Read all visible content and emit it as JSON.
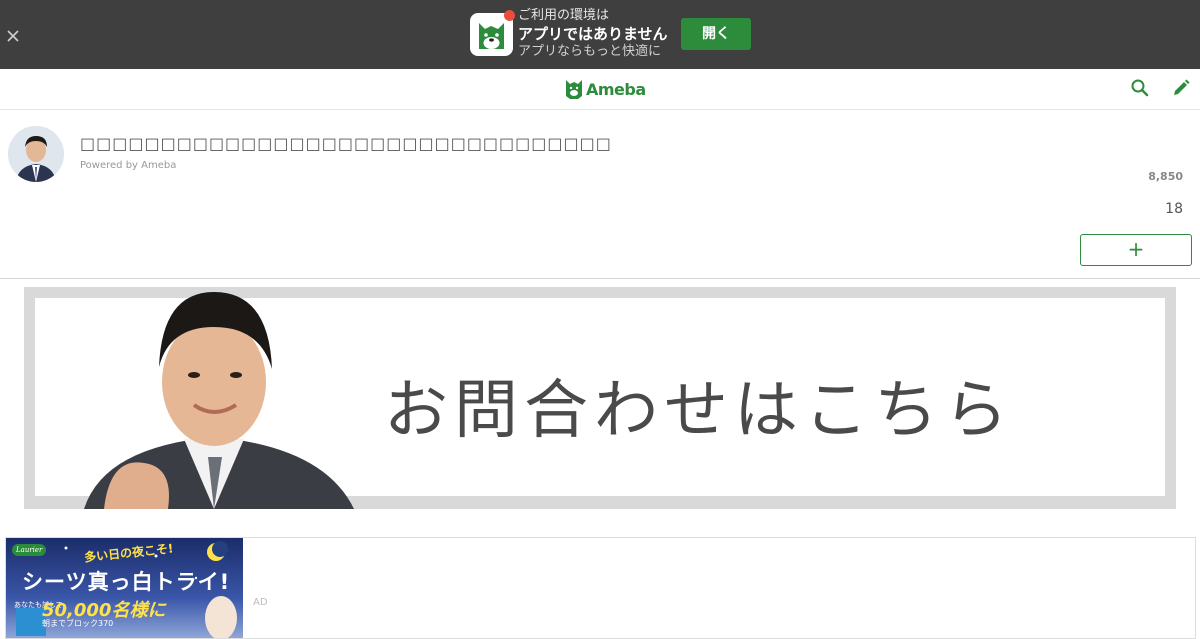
{
  "app_banner": {
    "line1": "ご利用の環境は",
    "line2": "アプリではありません",
    "line3": "アプリならもっと快適に",
    "open_label": "開く",
    "accent": "#2d8c3c",
    "badge_color": "#ec4d3a",
    "icons": {
      "close": "close-icon",
      "app": "ameba-app-icon"
    }
  },
  "header": {
    "logo_text": "Ameba",
    "icons": [
      "search-icon",
      "pencil-icon"
    ]
  },
  "blog": {
    "title": "□□□□□□□□□□□□□□□□□□□□□□□□□□□□□□□□□",
    "powered_by": "Powered by Ameba",
    "readers": "8,850",
    "posts": "18",
    "follow_label": "+"
  },
  "contact_banner": {
    "text": "お問合わせはこちら"
  },
  "ad": {
    "label": "AD",
    "brand": "Laurier",
    "catch": "多い日の夜こそ!",
    "headline": "シーツ真っ白トライ!",
    "count": "50,000名様に",
    "small_left": "あなたも試して",
    "small_bottom": "朝までブロック370"
  }
}
